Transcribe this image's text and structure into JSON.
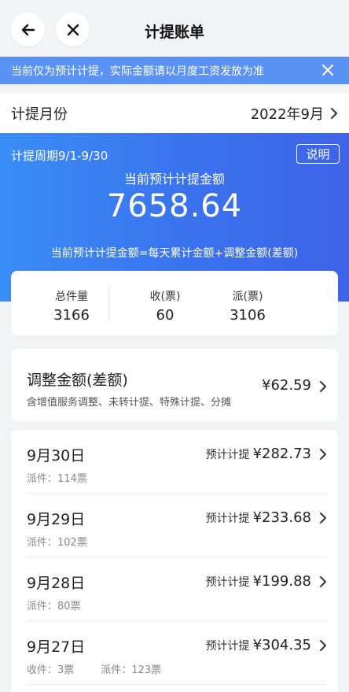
{
  "header": {
    "status_fragment": "...",
    "title": "计提账单",
    "back_icon": "back-arrow-icon",
    "close_icon": "close-icon"
  },
  "notice": {
    "text": "当前仅为预计计提，实际金额请以月度工资发放为准",
    "close_icon": "close-icon",
    "bg_color": "#5b93f5"
  },
  "month": {
    "label": "计提月份",
    "value": "2022年9月"
  },
  "summary": {
    "period": "计提周期9/1-9/30",
    "explain_label": "说明",
    "amount_label": "当前预计计提金额",
    "amount_value": "7658.64",
    "formula": "当前预计计提金额=每天累计金额+调整金额(差额)",
    "accent_color": "#3a72ee"
  },
  "stats": {
    "total_label": "总件量",
    "total_value": "3166",
    "recv_label": "收(票)",
    "recv_value": "60",
    "send_label": "派(票)",
    "send_value": "3106"
  },
  "adjust": {
    "title": "调整金额(差额)",
    "subtitle": "含增值服务调整、未转计提、特殊计提、分摊",
    "amount": "¥62.59"
  },
  "daily": [
    {
      "date": "9月30日",
      "prefix": "预计计提",
      "amount": "¥282.73",
      "sub": [
        "派件：114票"
      ]
    },
    {
      "date": "9月29日",
      "prefix": "预计计提",
      "amount": "¥233.68",
      "sub": [
        "派件：102票"
      ]
    },
    {
      "date": "9月28日",
      "prefix": "预计计提",
      "amount": "¥199.88",
      "sub": [
        "派件：80票"
      ]
    },
    {
      "date": "9月27日",
      "prefix": "预计计提",
      "amount": "¥304.35",
      "sub": [
        "收件：3票",
        "派件：123票"
      ]
    }
  ]
}
